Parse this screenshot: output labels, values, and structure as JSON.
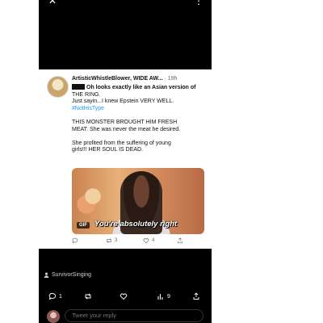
{
  "tweet": {
    "display_name": "ArtisticWhistleBlower, WIDE AW...",
    "time": "· 19h",
    "line1": "Oh looks exactly like an Asian version of",
    "line2": "THE RING.",
    "line3": "Just sayin...I knew Epstein VERY WELL.",
    "hashtag": "#NotHisType",
    "para2_line1": "THIS MONSTER BROUGHT HIM FRESH",
    "para2_line2": "MEAT. She was never the meat he desired.",
    "para3_line1": "She profited from the suffering of young",
    "para3_line2": "girls!!! HER SOUL IS DEAD.",
    "gif_badge": "GIF",
    "gif_caption": "You're absolutely right",
    "retweets": "3",
    "likes": "4"
  },
  "overlay": {
    "username": "SurvivorSinging",
    "replies": "1",
    "views": "9",
    "reply_placeholder": "Tweet your reply"
  },
  "icons": [
    "close-icon",
    "more-icon",
    "reply-icon",
    "retweet-icon",
    "like-icon",
    "share-icon",
    "user-icon",
    "views-icon"
  ]
}
